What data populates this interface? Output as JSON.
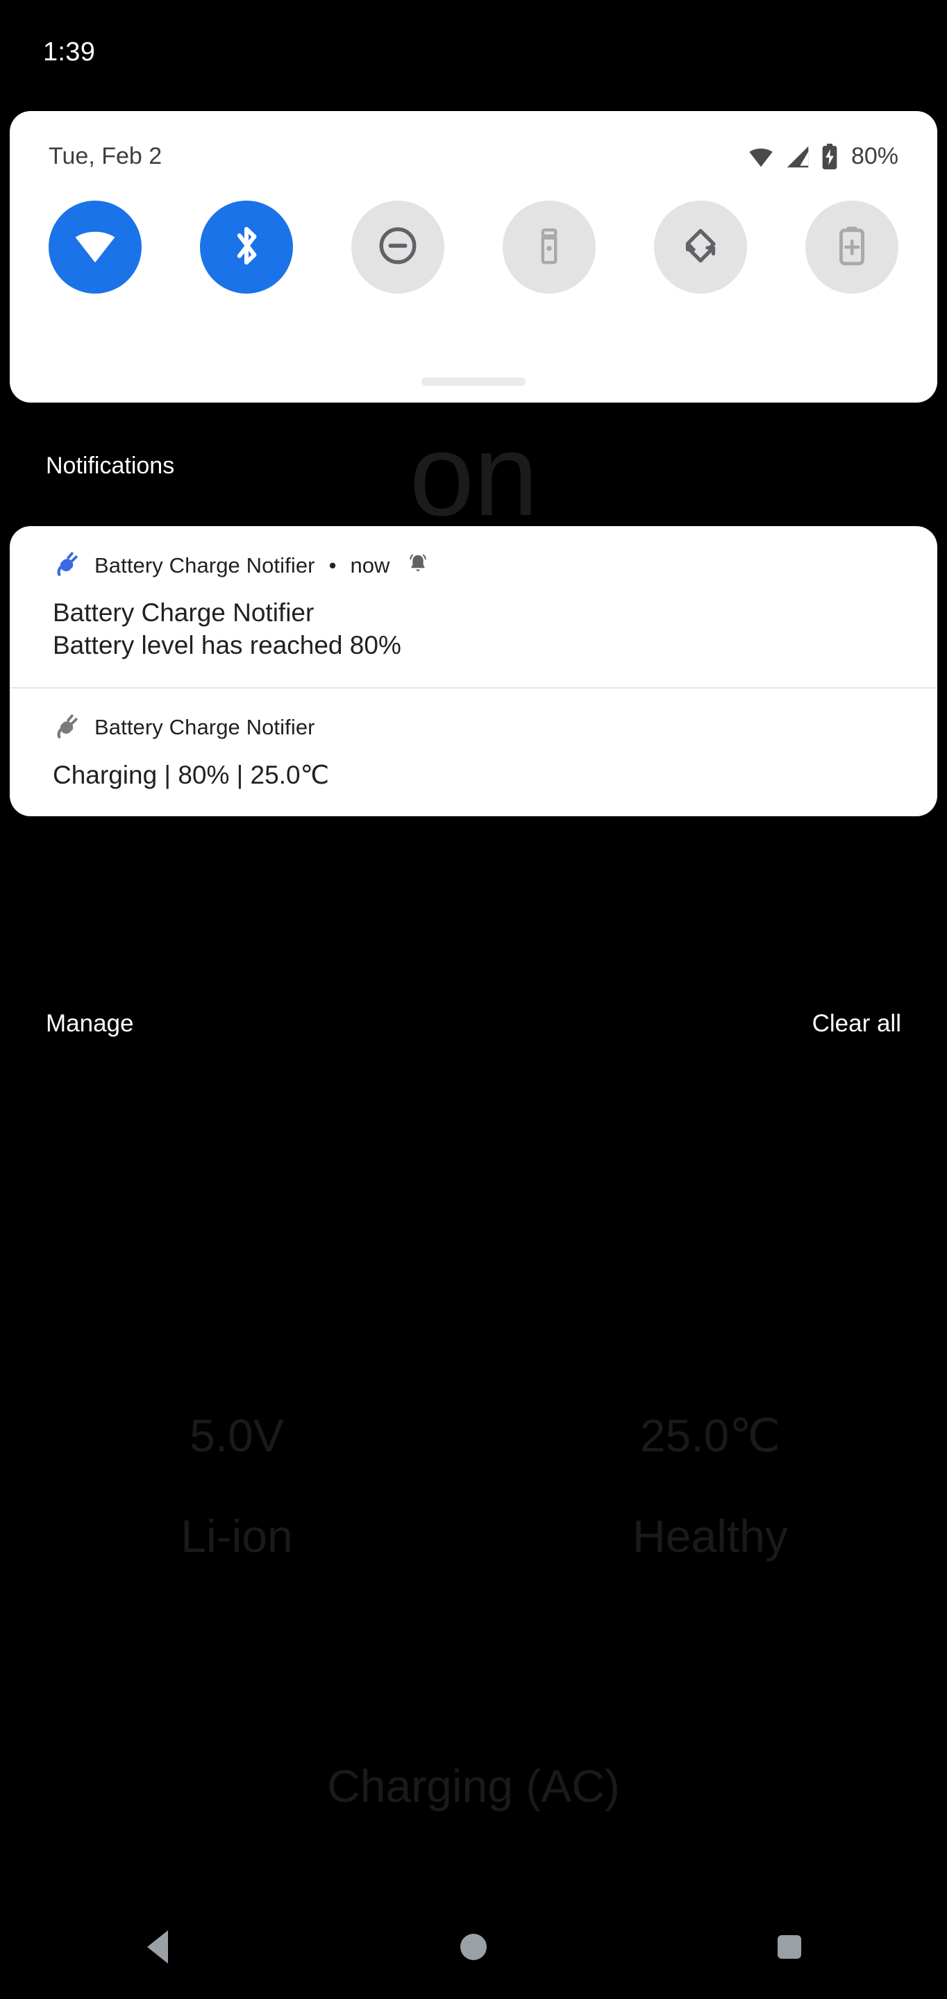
{
  "status_bar": {
    "clock": "1:39"
  },
  "quick_settings": {
    "date": "Tue, Feb 2",
    "battery_percent": "80%",
    "status_icons": [
      {
        "name": "wifi-icon",
        "label": "Wi-Fi signal full"
      },
      {
        "name": "cellular-signal-icon",
        "label": "Mobile signal"
      },
      {
        "name": "battery-charging-icon",
        "label": "Battery charging"
      }
    ],
    "tiles": [
      {
        "name": "wifi",
        "label": "Wi-Fi",
        "state": "on"
      },
      {
        "name": "bluetooth",
        "label": "Bluetooth",
        "state": "on"
      },
      {
        "name": "do-not-disturb",
        "label": "Do Not Disturb",
        "state": "off"
      },
      {
        "name": "flashlight",
        "label": "Flashlight",
        "state": "off-dim"
      },
      {
        "name": "auto-rotate",
        "label": "Auto-rotate",
        "state": "off"
      },
      {
        "name": "battery-saver",
        "label": "Battery Saver",
        "state": "off-dim"
      }
    ],
    "drag_handle": "drag-handle"
  },
  "notifications_section": {
    "header": "Notifications",
    "items": [
      {
        "app_name": "Battery Charge Notifier",
        "separator": "•",
        "time": "now",
        "alert_icon": "bell-ringing-icon",
        "app_icon": "plug-icon-blue",
        "title": "Battery Charge Notifier",
        "text": "Battery level has reached 80%"
      },
      {
        "app_name": "Battery Charge Notifier",
        "app_icon": "plug-icon-gray",
        "body": "Charging | 80% | 25.0℃"
      }
    ],
    "actions": {
      "manage": "Manage",
      "clear_all": "Clear all"
    }
  },
  "background_app": {
    "hero_text": "on",
    "rows": [
      {
        "left": "5.0V",
        "right": "25.0℃"
      },
      {
        "left": "Li-ion",
        "right": "Healthy"
      }
    ],
    "status_line": "Charging (AC)"
  },
  "navigation_bar": {
    "back": "back-button",
    "home": "home-button",
    "recents": "recents-button"
  },
  "colors": {
    "accent_blue": "#1a73e8",
    "card_white": "#ffffff",
    "background_black": "#000000",
    "tile_off_gray": "#e3e3e3",
    "nav_icon_gray": "#9aa0a6"
  }
}
